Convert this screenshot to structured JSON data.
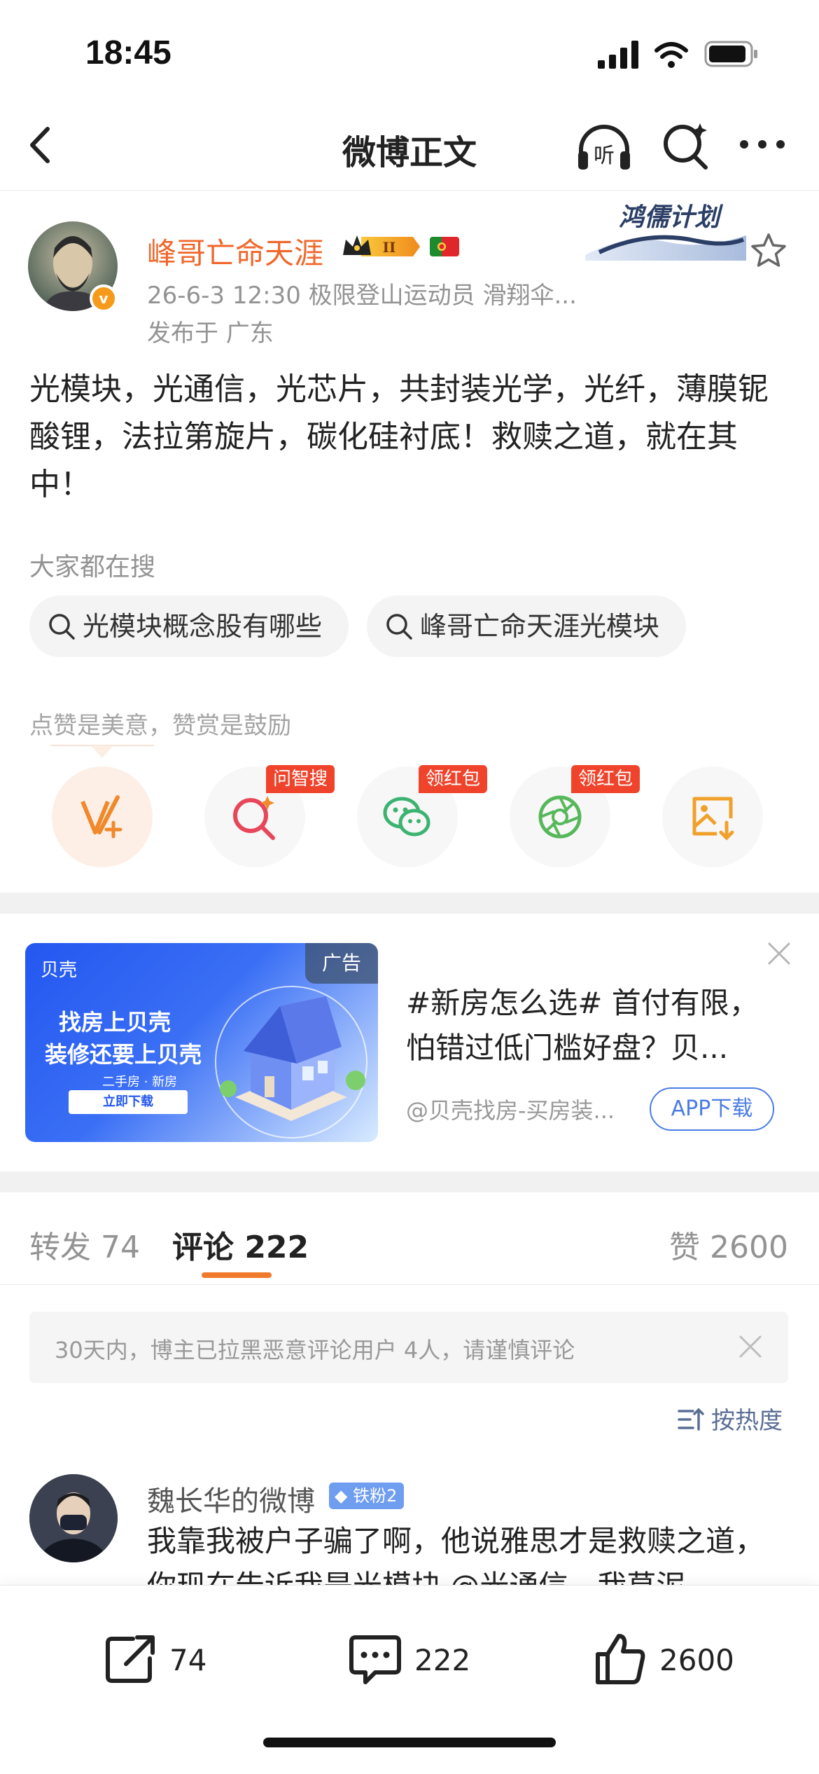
{
  "status": {
    "time": "18:45"
  },
  "nav": {
    "title": "微博正文",
    "listen_icon_label": "听"
  },
  "post": {
    "username": "峰哥亡命天涯",
    "level_badge": "II",
    "verified_mark": "v",
    "plan_badge": "鸿儒计划",
    "meta": "26-6-3 12:30  极限登山运动员 滑翔伞...",
    "location": "发布于 广东",
    "body": "光模块，光通信，光芯片，共封装光学，光纤，薄膜铌酸锂，法拉第旋片，碳化硅衬底！救赎之道，就在其中！"
  },
  "search": {
    "title": "大家都在搜",
    "chips": [
      "光模块概念股有哪些",
      "峰哥亡命天涯光模块"
    ]
  },
  "actions": {
    "hint": "点赞是美意，赞赏是鼓励",
    "tags": [
      "问智搜",
      "领红包",
      "领红包"
    ]
  },
  "ad": {
    "logo": "贝壳",
    "slogan1": "找房上贝壳",
    "slogan2": "装修还要上贝壳",
    "small": "二手房 · 新房",
    "button": "立即下载",
    "tag": "广告",
    "text": "#新房怎么选# 首付有限，怕错过低门槛好盘？贝...",
    "source": "@贝壳找房-买房装...",
    "download": "APP下载"
  },
  "tabs": {
    "repost": "转发 74",
    "comment": "评论 222",
    "like": "赞 2600"
  },
  "notice": "30天内，博主已拉黑恶意评论用户 4人，请谨慎评论",
  "sort": "按热度",
  "comment": {
    "name": "魏长华的微博",
    "badge": "铁粉2",
    "text": "我靠我被户子骗了啊，他说雅思才是救赎之道，你现在告诉我是光模块 @光通信，我草泥"
  },
  "bottom": {
    "repost": "74",
    "comment": "222",
    "like": "2600"
  },
  "colors": {
    "accent": "#f07a2b",
    "username": "#f0672b",
    "link": "#4a7ce5",
    "tag_red": "#f0432b"
  }
}
